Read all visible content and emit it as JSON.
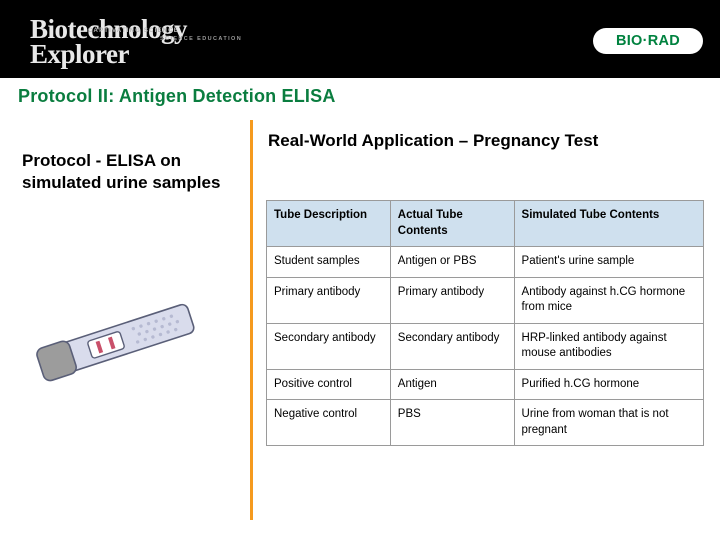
{
  "header": {
    "logo_line1": "Biotechnology",
    "logo_line2": "Explorer",
    "logo_tagline": "CAPTIVATING SCIENCE",
    "logo_tagline2": "SCIENCE EDUCATION",
    "brand_logo_text": "BIO·RAD"
  },
  "title": "Protocol II: Antigen Detection ELISA",
  "left": {
    "heading": "Protocol - ELISA on simulated urine samples",
    "illustration_name": "pregnancy-test-strip"
  },
  "right": {
    "heading": "Real-World Application – Pregnancy Test",
    "table": {
      "headers": [
        "Tube Description",
        "Actual Tube Contents",
        "Simulated Tube Contents"
      ],
      "rows": [
        [
          "Student samples",
          "Antigen or PBS",
          "Patient's urine sample"
        ],
        [
          "Primary antibody",
          "Primary antibody",
          "Antibody against h.CG hormone from mice"
        ],
        [
          "Secondary antibody",
          "Secondary antibody",
          "HRP-linked antibody against mouse antibodies"
        ],
        [
          "Positive control",
          "Antigen",
          "Purified h.CG hormone"
        ],
        [
          "Negative control",
          "PBS",
          "Urine from woman that is not pregnant"
        ]
      ]
    }
  },
  "colors": {
    "title_green": "#0a7d3f",
    "divider_orange": "#f59a1e",
    "table_header_blue": "#cfe0ee",
    "header_band": "#000000"
  }
}
